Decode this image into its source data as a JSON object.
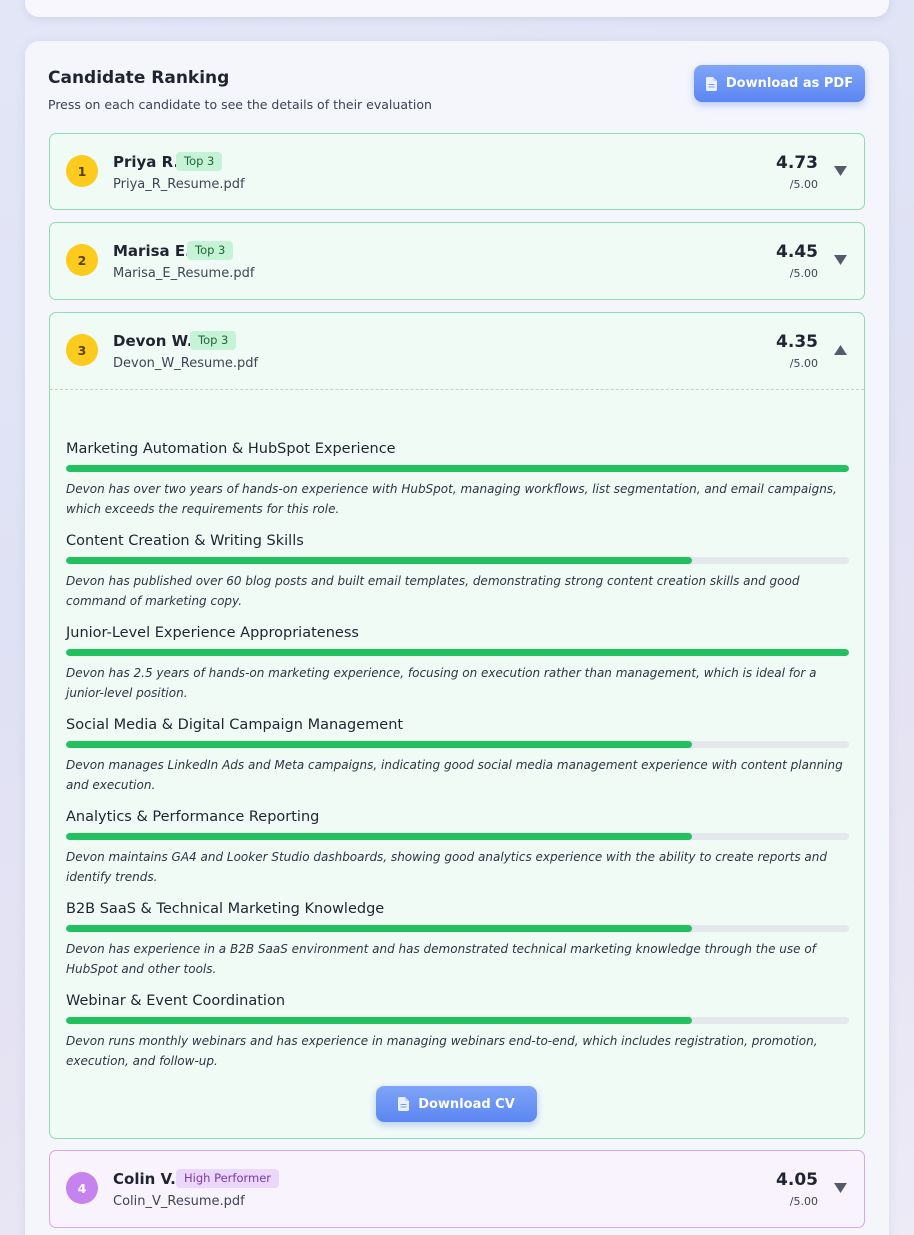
{
  "ranking": {
    "title": "Candidate Ranking",
    "subtitle": "Press on each candidate to see the details of their evaluation",
    "download_pdf_label": "Download as PDF"
  },
  "candidates": [
    {
      "rank": "1",
      "name": "Priya R.",
      "badge": "Top 3",
      "file": "Priya_R_Resume.pdf",
      "score": "4.73",
      "out_of": "/5.00",
      "expanded": false
    },
    {
      "rank": "2",
      "name": "Marisa E.",
      "badge": "Top 3",
      "file": "Marisa_E_Resume.pdf",
      "score": "4.45",
      "out_of": "/5.00",
      "expanded": false
    },
    {
      "rank": "3",
      "name": "Devon W.",
      "badge": "Top 3",
      "file": "Devon_W_Resume.pdf",
      "score": "4.35",
      "out_of": "/5.00",
      "expanded": true,
      "download_cv_label": "Download CV",
      "criteria": [
        {
          "title": "Marketing Automation & HubSpot Experience",
          "score_fraction": 1.0,
          "description": "Devon has over two years of hands-on experience with HubSpot, managing workflows, list segmentation, and email campaigns, which exceeds the requirements for this role."
        },
        {
          "title": "Content Creation & Writing Skills",
          "score_fraction": 0.8,
          "description": "Devon has published over 60 blog posts and built email templates, demonstrating strong content creation skills and good command of marketing copy."
        },
        {
          "title": "Junior-Level Experience Appropriateness",
          "score_fraction": 1.0,
          "description": "Devon has 2.5 years of hands-on marketing experience, focusing on execution rather than management, which is ideal for a junior-level position."
        },
        {
          "title": "Social Media & Digital Campaign Management",
          "score_fraction": 0.8,
          "description": "Devon manages LinkedIn Ads and Meta campaigns, indicating good social media management experience with content planning and execution."
        },
        {
          "title": "Analytics & Performance Reporting",
          "score_fraction": 0.8,
          "description": "Devon maintains GA4 and Looker Studio dashboards, showing good analytics experience with the ability to create reports and identify trends."
        },
        {
          "title": "B2B SaaS & Technical Marketing Knowledge",
          "score_fraction": 0.8,
          "description": "Devon has experience in a B2B SaaS environment and has demonstrated technical marketing knowledge through the use of HubSpot and other tools."
        },
        {
          "title": "Webinar & Event Coordination",
          "score_fraction": 0.8,
          "description": "Devon runs monthly webinars and has experience in managing webinars end-to-end, which includes registration, promotion, execution, and follow-up."
        }
      ]
    },
    {
      "rank": "4",
      "name": "Colin V.",
      "badge": "High Performer",
      "file": "Colin_V_Resume.pdf",
      "score": "4.05",
      "out_of": "/5.00",
      "expanded": false
    }
  ],
  "colors": {
    "accent_blue": "#5b86f2",
    "bar_green": "#22c05e",
    "rank_gold": "#fccb1e",
    "rank_purple": "#c683ee"
  }
}
